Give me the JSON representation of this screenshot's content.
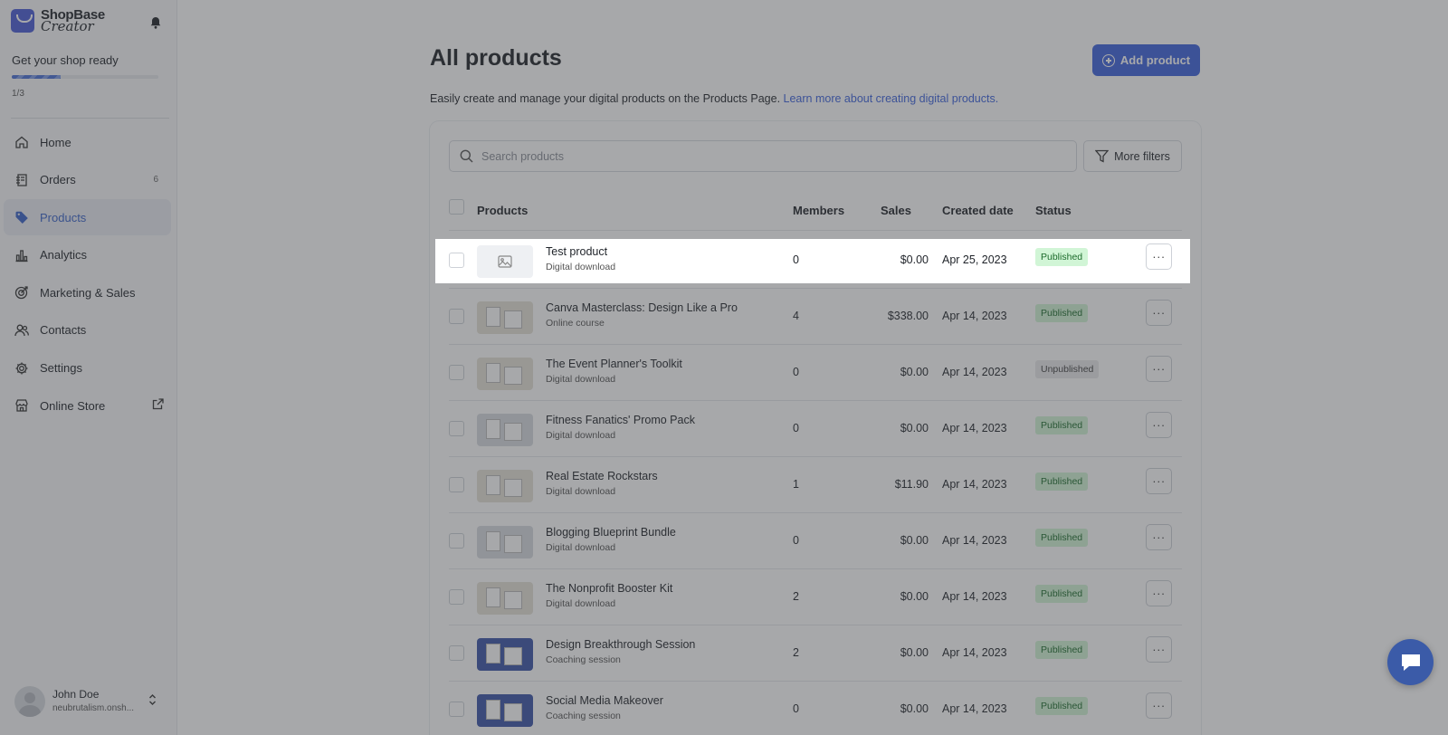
{
  "brand": {
    "line1": "ShopBase",
    "line2": "Creator"
  },
  "onboarding": {
    "title": "Get your shop ready",
    "progress": "1/3",
    "progress_fraction": 0.333
  },
  "nav": [
    {
      "label": "Home",
      "icon": "home-icon"
    },
    {
      "label": "Orders",
      "icon": "orders-icon",
      "count": "6"
    },
    {
      "label": "Products",
      "icon": "tag-icon",
      "active": true
    },
    {
      "label": "Analytics",
      "icon": "analytics-icon"
    },
    {
      "label": "Marketing & Sales",
      "icon": "target-icon"
    },
    {
      "label": "Contacts",
      "icon": "contacts-icon"
    },
    {
      "label": "Settings",
      "icon": "gear-icon"
    },
    {
      "label": "Online Store",
      "icon": "store-icon"
    }
  ],
  "user": {
    "name": "John Doe",
    "shop": "neubrutalism.onsh..."
  },
  "page": {
    "title": "All products",
    "add_button": "Add product",
    "description": "Easily create and manage your digital products on the Products Page.",
    "learn_more": "Learn more about creating digital products."
  },
  "search": {
    "placeholder": "Search products"
  },
  "filters": {
    "label": "More filters"
  },
  "table": {
    "headers": {
      "products": "Products",
      "members": "Members",
      "sales": "Sales",
      "created": "Created date",
      "status": "Status"
    },
    "rows": [
      {
        "name": "Test product",
        "type": "Digital download",
        "members": "0",
        "sales": "$0.00",
        "created": "Apr 25, 2023",
        "status": "Published"
      },
      {
        "name": "Canva Masterclass: Design Like a Pro",
        "type": "Online course",
        "members": "4",
        "sales": "$338.00",
        "created": "Apr 14, 2023",
        "status": "Published"
      },
      {
        "name": "The Event Planner's Toolkit",
        "type": "Digital download",
        "members": "0",
        "sales": "$0.00",
        "created": "Apr 14, 2023",
        "status": "Unpublished"
      },
      {
        "name": "Fitness Fanatics' Promo Pack",
        "type": "Digital download",
        "members": "0",
        "sales": "$0.00",
        "created": "Apr 14, 2023",
        "status": "Published"
      },
      {
        "name": "Real Estate Rockstars",
        "type": "Digital download",
        "members": "1",
        "sales": "$11.90",
        "created": "Apr 14, 2023",
        "status": "Published"
      },
      {
        "name": "Blogging Blueprint Bundle",
        "type": "Digital download",
        "members": "0",
        "sales": "$0.00",
        "created": "Apr 14, 2023",
        "status": "Published"
      },
      {
        "name": "The Nonprofit Booster Kit",
        "type": "Digital download",
        "members": "2",
        "sales": "$0.00",
        "created": "Apr 14, 2023",
        "status": "Published"
      },
      {
        "name": "Design Breakthrough Session",
        "type": "Coaching session",
        "members": "2",
        "sales": "$0.00",
        "created": "Apr 14, 2023",
        "status": "Published"
      },
      {
        "name": "Social Media Makeover",
        "type": "Coaching session",
        "members": "0",
        "sales": "$0.00",
        "created": "Apr 14, 2023",
        "status": "Published"
      }
    ],
    "more_label": "···"
  },
  "colors": {
    "accent": "#3d63dd",
    "published_bg": "#d1f5d6",
    "unpublished_bg": "#e9eaec"
  }
}
